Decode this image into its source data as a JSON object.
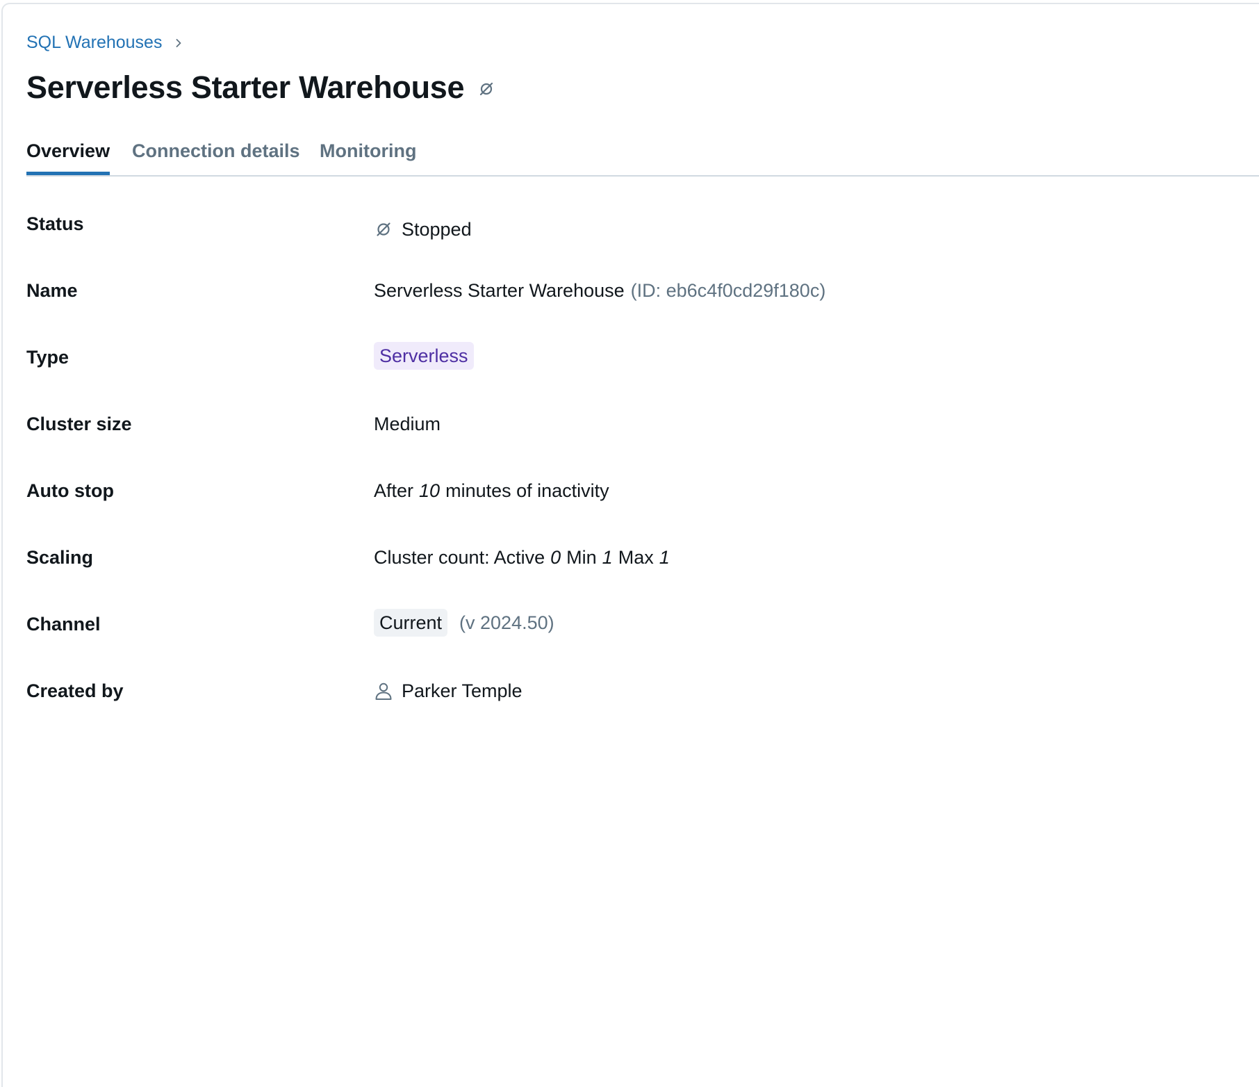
{
  "breadcrumb": {
    "parent_label": "SQL Warehouses"
  },
  "page": {
    "title": "Serverless Starter Warehouse",
    "title_status_icon": "stopped-icon"
  },
  "tabs": [
    {
      "label": "Overview",
      "active": true
    },
    {
      "label": "Connection details",
      "active": false
    },
    {
      "label": "Monitoring",
      "active": false
    }
  ],
  "properties": {
    "status": {
      "label": "Status",
      "icon": "stopped-icon",
      "value": "Stopped"
    },
    "name": {
      "label": "Name",
      "value": "Serverless Starter Warehouse",
      "id_text": "(ID: eb6c4f0cd29f180c)"
    },
    "type": {
      "label": "Type",
      "value": "Serverless"
    },
    "cluster_size": {
      "label": "Cluster size",
      "value": "Medium"
    },
    "auto_stop": {
      "label": "Auto stop",
      "prefix": "After",
      "minutes": "10",
      "suffix": "minutes of inactivity"
    },
    "scaling": {
      "label": "Scaling",
      "prefix": "Cluster count: Active",
      "active": "0",
      "min_label": "Min",
      "min": "1",
      "max_label": "Max",
      "max": "1"
    },
    "channel": {
      "label": "Channel",
      "value": "Current",
      "version": "(v 2024.50)"
    },
    "created_by": {
      "label": "Created by",
      "icon": "user-icon",
      "value": "Parker Temple"
    }
  },
  "colors": {
    "link": "#2272b4",
    "tab_active_underline": "#2272b4",
    "serverless_tag_bg": "#f0ebfb",
    "serverless_tag_text": "#4e2fa3",
    "muted_text": "#5f7281"
  }
}
